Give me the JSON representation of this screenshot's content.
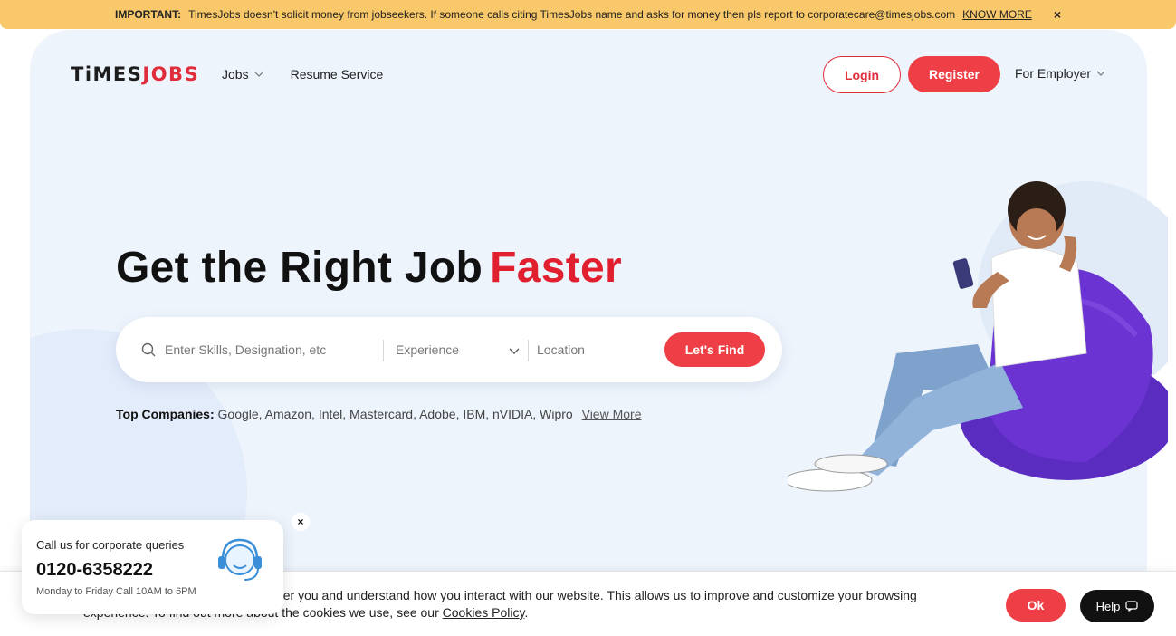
{
  "notice": {
    "label": "IMPORTANT:",
    "message": "TimesJobs doesn't solicit money from jobseekers. If someone calls citing TimesJobs name and asks for money then pls report to corporatecare@timesjobs.com",
    "link": "KNOW MORE",
    "close": "×"
  },
  "header": {
    "logo_part1": "TiMES",
    "logo_part2": "JOBS",
    "nav": [
      {
        "label": "Jobs"
      },
      {
        "label": "Resume Service"
      }
    ],
    "login_label": "Login",
    "register_label": "Register",
    "employer_label": "For Employer"
  },
  "hero": {
    "headline": "Get the Right Job",
    "headline_accent": "Faster"
  },
  "search": {
    "skills_placeholder": "Enter Skills, Designation, etc",
    "experience_label": "Experience",
    "location_placeholder": "Location",
    "button_label": "Let's Find"
  },
  "companies": {
    "label": "Top Companies:",
    "list": "Google, Amazon, Intel, Mastercard, Adobe, IBM, nVIDIA, Wipro",
    "view_more": "View More"
  },
  "popup": {
    "title": "Call us for corporate queries",
    "phone": "0120-6358222",
    "hours": "Monday to Friday Call 10AM to 6PM",
    "close": "×"
  },
  "cookie": {
    "text": "We use cookies so we can remember you and understand how you interact with our website. This allows us to improve and customize your browsing experience. To find out more about the cookies we use, see our",
    "policy_link": "Cookies Policy",
    "period": ".",
    "ok_label": "Ok",
    "help_label": "Help"
  },
  "colors": {
    "brand_red": "#ee3e46",
    "notice_bg": "#f8c86a",
    "hero_bg": "#eef4fc"
  }
}
